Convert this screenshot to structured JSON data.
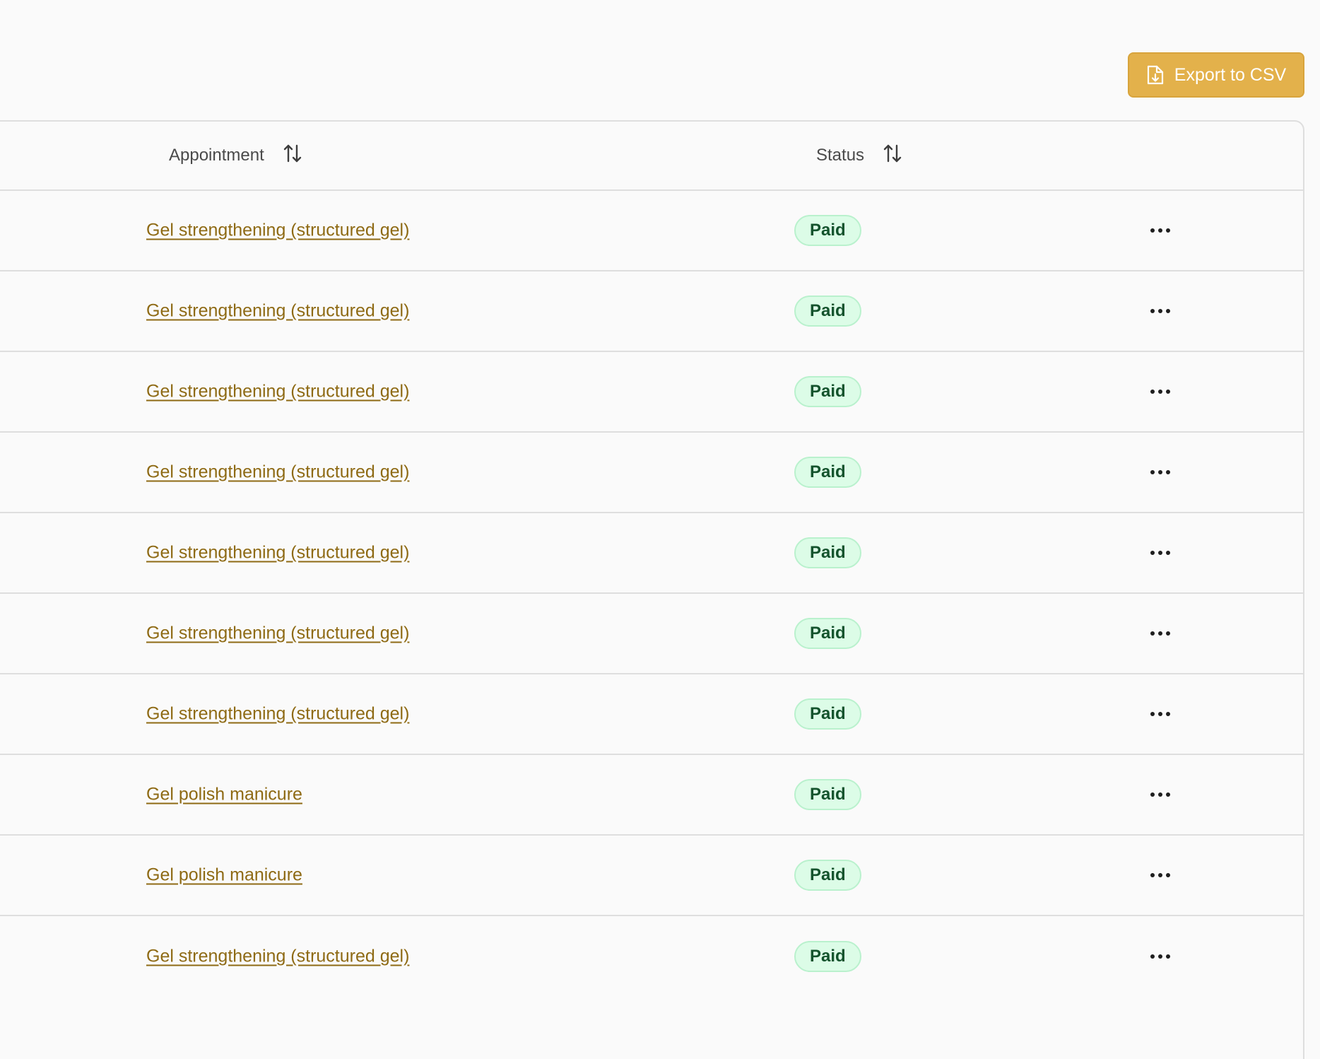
{
  "toolbar": {
    "export_label": "Export to CSV"
  },
  "table": {
    "columns": {
      "appointment": "Appointment",
      "status": "Status"
    },
    "rows": [
      {
        "appointment": "Gel strengthening (structured gel)",
        "status": "Paid"
      },
      {
        "appointment": "Gel strengthening (structured gel)",
        "status": "Paid"
      },
      {
        "appointment": "Gel strengthening (structured gel)",
        "status": "Paid"
      },
      {
        "appointment": "Gel strengthening (structured gel)",
        "status": "Paid"
      },
      {
        "appointment": "Gel strengthening (structured gel)",
        "status": "Paid"
      },
      {
        "appointment": "Gel strengthening (structured gel)",
        "status": "Paid"
      },
      {
        "appointment": "Gel strengthening (structured gel)",
        "status": "Paid"
      },
      {
        "appointment": "Gel polish manicure",
        "status": "Paid"
      },
      {
        "appointment": "Gel polish manicure",
        "status": "Paid"
      },
      {
        "appointment": "Gel strengthening (structured gel)",
        "status": "Paid"
      }
    ]
  },
  "icons": {
    "export": "file-download-icon",
    "sort": "sort-arrows-icon",
    "row_actions": "more-horizontal-icon"
  },
  "colors": {
    "accent": "#e3b14b",
    "link": "#8e6a14",
    "badge_bg": "#dcfce7",
    "badge_text": "#14532d"
  }
}
